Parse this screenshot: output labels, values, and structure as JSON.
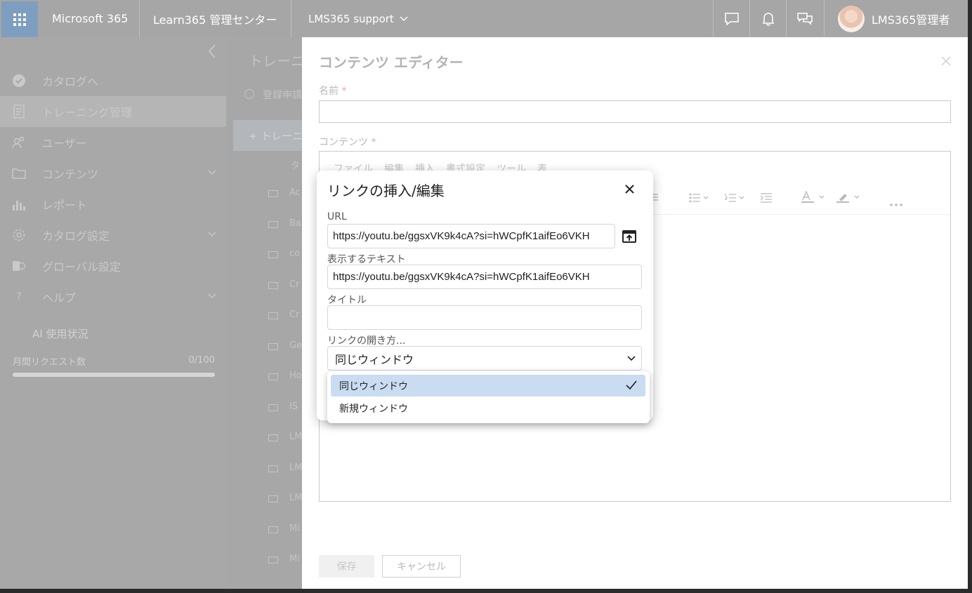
{
  "topbar": {
    "brand": "Microsoft 365",
    "app": "Learn365 管理センター",
    "tenant": "LMS365 support",
    "user": "LMS365管理者"
  },
  "sidebar": {
    "items": [
      {
        "label": "カタログへ",
        "icon": "catalog-check-icon"
      },
      {
        "label": "トレーニング管理",
        "icon": "training-doc-icon"
      },
      {
        "label": "ユーザー",
        "icon": "users-icon"
      },
      {
        "label": "コンテンツ",
        "icon": "folder-icon"
      },
      {
        "label": "レポート",
        "icon": "chart-icon"
      },
      {
        "label": "カタログ設定",
        "icon": "gear-icon"
      },
      {
        "label": "グローバル設定",
        "icon": "global-settings-icon"
      },
      {
        "label": "ヘルプ",
        "icon": "help-icon"
      }
    ],
    "ai_usage_title": "AI 使用状況",
    "monthly_label": "月間リクエスト数",
    "monthly_value": "0/100",
    "monthly_fraction": 0
  },
  "background": {
    "page_title": "トレーニ",
    "info_text": "登録申請",
    "add_button": "+ トレーニ",
    "col_header": "タ",
    "rows": [
      "Ac",
      "Ba",
      "co",
      "Cr",
      "Cr",
      "Ge",
      "Ho",
      "IS",
      "LM",
      "LM",
      "LM",
      "Mi",
      "Mi"
    ]
  },
  "editor": {
    "title": "コンテンツ エディター",
    "name_label": "名前",
    "content_label": "コンテンツ",
    "required_mark": "*",
    "menu": [
      "ファイル",
      "編集",
      "挿入",
      "書式設定",
      "ツール",
      "表"
    ],
    "save_label": "保存",
    "cancel_label": "キャンセル"
  },
  "dialog": {
    "title": "リンクの挿入/編集",
    "url_label": "URL",
    "url_value": "https://youtu.be/ggsxVK9k4cA?si=hWCpfK1aifEo6VKH",
    "text_label": "表示するテキスト",
    "text_value": "https://youtu.be/ggsxVK9k4cA?si=hWCpfK1aifEo6VKH",
    "title_label": "タイトル",
    "title_value": "",
    "open_label": "リンクの開き方...",
    "open_value": "同じウィンドウ",
    "options": [
      "同じウィンドウ",
      "新規ウィンドウ"
    ]
  }
}
